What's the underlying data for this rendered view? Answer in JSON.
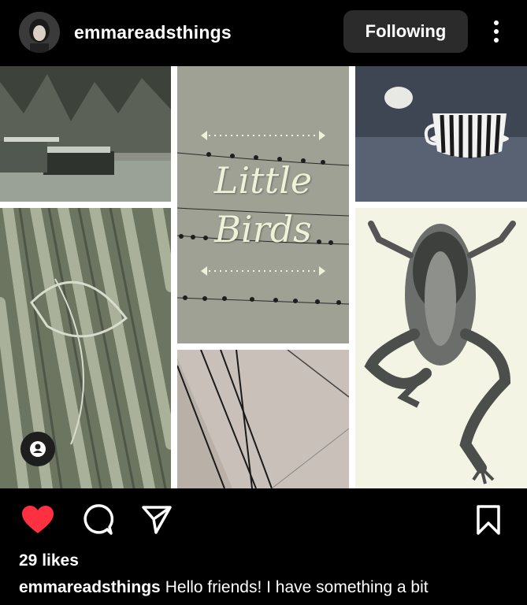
{
  "header": {
    "username": "emmareadsthings",
    "follow_label": "Following"
  },
  "post": {
    "collage_title_line1": "Little",
    "collage_title_line2": "Birds"
  },
  "actions": {
    "like_color": "#ff3040"
  },
  "likes_text": "29 likes",
  "caption": {
    "username": "emmareadsthings",
    "text": "Hello friends! I have something a bit"
  },
  "icons": [
    "heart-icon",
    "comment-icon",
    "share-icon",
    "bookmark-icon",
    "more-icon",
    "user-tag-icon"
  ]
}
